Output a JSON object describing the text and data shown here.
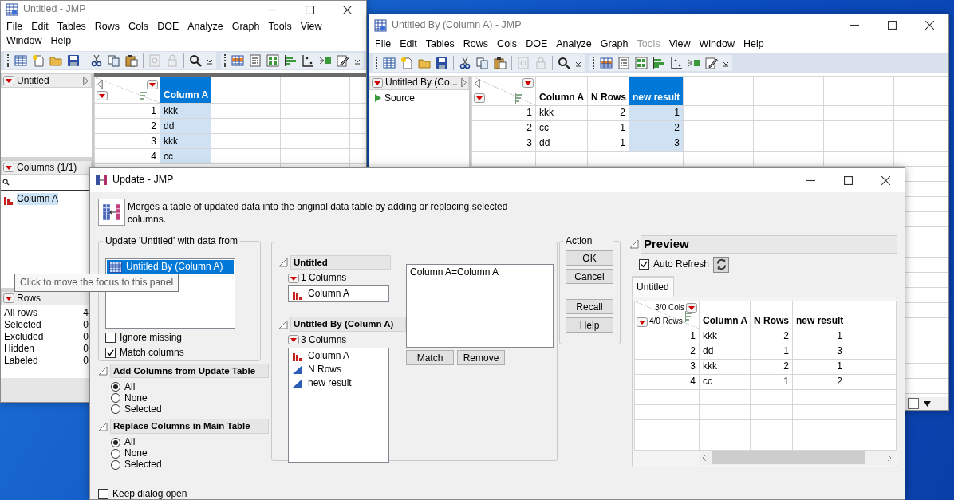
{
  "data_window": {
    "title": "Untitled - JMP",
    "menu": [
      {
        "label": "File",
        "disabled": false
      },
      {
        "label": "Edit",
        "disabled": false
      },
      {
        "label": "Tables",
        "disabled": false
      },
      {
        "label": "Rows",
        "disabled": false
      },
      {
        "label": "Cols",
        "disabled": false
      },
      {
        "label": "DOE",
        "disabled": false
      },
      {
        "label": "Analyze",
        "disabled": false
      },
      {
        "label": "Graph",
        "disabled": false
      },
      {
        "label": "Tools",
        "disabled": false
      },
      {
        "label": "View",
        "disabled": false
      },
      {
        "label": "Window",
        "disabled": false
      },
      {
        "label": "Help",
        "disabled": false
      }
    ],
    "table_panel": {
      "title": "Untitled"
    },
    "columns_panel": {
      "title": "Columns (1/1)",
      "columns": [
        {
          "name": "Column A",
          "kind": "nominal",
          "selected": true
        }
      ]
    },
    "rows_panel": {
      "title": "Rows",
      "items": [
        {
          "label": "All rows",
          "value": "4"
        },
        {
          "label": "Selected",
          "value": "0"
        },
        {
          "label": "Excluded",
          "value": "0"
        },
        {
          "label": "Hidden",
          "value": "0"
        },
        {
          "label": "Labeled",
          "value": "0"
        }
      ]
    },
    "grid": {
      "columns": [
        {
          "name": "Column A",
          "kind": "character",
          "selected": true
        }
      ],
      "rows": [
        {
          "number": "1",
          "cells": [
            "kkk"
          ]
        },
        {
          "number": "2",
          "cells": [
            "dd"
          ]
        },
        {
          "number": "3",
          "cells": [
            "kkk"
          ]
        },
        {
          "number": "4",
          "cells": [
            "cc"
          ]
        }
      ]
    }
  },
  "by_window": {
    "title": "Untitled By (Column A) - JMP",
    "menu": [
      {
        "label": "File",
        "disabled": false
      },
      {
        "label": "Edit",
        "disabled": false
      },
      {
        "label": "Tables",
        "disabled": false
      },
      {
        "label": "Rows",
        "disabled": false
      },
      {
        "label": "Cols",
        "disabled": false
      },
      {
        "label": "DOE",
        "disabled": false
      },
      {
        "label": "Analyze",
        "disabled": false
      },
      {
        "label": "Graph",
        "disabled": false
      },
      {
        "label": "Tools",
        "disabled": true
      },
      {
        "label": "View",
        "disabled": false
      },
      {
        "label": "Window",
        "disabled": false
      },
      {
        "label": "Help",
        "disabled": false
      }
    ],
    "table_panel": {
      "title": "Untitled By (Co...",
      "scripts": [
        "Source"
      ]
    },
    "grid": {
      "columns": [
        {
          "name": "Column A",
          "kind": "character",
          "selected": false
        },
        {
          "name": "N Rows",
          "kind": "numeric",
          "selected": false
        },
        {
          "name": "new result",
          "kind": "numeric",
          "selected": true
        }
      ],
      "rows": [
        {
          "number": "1",
          "cells": [
            "kkk",
            "2",
            "1"
          ]
        },
        {
          "number": "2",
          "cells": [
            "cc",
            "1",
            "2"
          ]
        },
        {
          "number": "3",
          "cells": [
            "dd",
            "1",
            "3"
          ]
        }
      ]
    }
  },
  "update_dialog": {
    "title": "Update - JMP",
    "description": "Merges a table of updated data into the original data table by adding or replacing selected columns.",
    "source_group": {
      "title": "Update 'Untitled' with data from",
      "tables": [
        {
          "label": "Untitled By (Column A)",
          "selected": true
        }
      ],
      "options": [
        {
          "label": "Ignore missing",
          "checked": false
        },
        {
          "label": "Match columns",
          "checked": true
        }
      ]
    },
    "add_columns": {
      "title": "Add Columns from Update Table",
      "options": [
        {
          "label": "All",
          "selected": true
        },
        {
          "label": "None",
          "selected": false
        },
        {
          "label": "Selected",
          "selected": false
        }
      ]
    },
    "replace_columns": {
      "title": "Replace Columns in Main Table",
      "options": [
        {
          "label": "All",
          "selected": true
        },
        {
          "label": "None",
          "selected": false
        },
        {
          "label": "Selected",
          "selected": false
        }
      ]
    },
    "keep_open": {
      "label": "Keep dialog open",
      "checked": false
    },
    "match_panel": {
      "main_table": {
        "title": "Untitled",
        "count": "1 Columns",
        "columns": [
          {
            "name": "Column A",
            "kind": "nominal"
          }
        ]
      },
      "update_table": {
        "title": "Untitled By (Column A)",
        "count": "3 Columns",
        "columns": [
          {
            "name": "Column A",
            "kind": "nominal"
          },
          {
            "name": "N Rows",
            "kind": "continuous"
          },
          {
            "name": "new result",
            "kind": "continuous"
          }
        ]
      },
      "matches": [
        "Column A=Column A"
      ],
      "buttons": [
        "Match",
        "Remove"
      ]
    },
    "action": {
      "title": "Action",
      "buttons": [
        "OK",
        "Cancel",
        "Recall",
        "Help"
      ]
    },
    "preview": {
      "title": "Preview",
      "auto_refresh": {
        "label": "Auto Refresh",
        "checked": true
      },
      "tabs": [
        {
          "label": "Untitled",
          "selected": true
        }
      ],
      "cols_summary": "3/0 Cols",
      "rows_summary": "4/0 Rows",
      "columns": [
        {
          "name": "Column A",
          "kind": "character"
        },
        {
          "name": "N Rows",
          "kind": "numeric"
        },
        {
          "name": "new result",
          "kind": "numeric"
        }
      ],
      "rows": [
        {
          "number": "1",
          "cells": [
            "kkk",
            "2",
            "1"
          ]
        },
        {
          "number": "2",
          "cells": [
            "dd",
            "1",
            "3"
          ]
        },
        {
          "number": "3",
          "cells": [
            "kkk",
            "2",
            "1"
          ]
        },
        {
          "number": "4",
          "cells": [
            "cc",
            "1",
            "2"
          ]
        }
      ]
    }
  },
  "tooltip": {
    "text": "Click to move the focus to this panel"
  }
}
